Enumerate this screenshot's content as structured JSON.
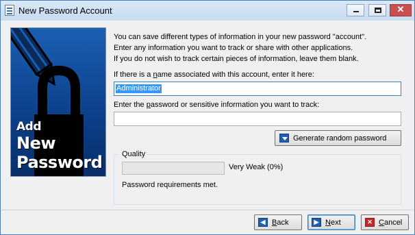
{
  "window": {
    "title": "New Password Account",
    "close_glyph": "✕"
  },
  "banner": {
    "line1": "Add",
    "line2": "New",
    "line3": "Password"
  },
  "intro": {
    "line1": "You can save different types of information in your new password \"account\".",
    "line2": "Enter any information you want to track or share with other applications.",
    "line3": "If you do not wish to track certain pieces of information, leave them blank."
  },
  "name_field": {
    "label_pre": "If there is a ",
    "label_key": "n",
    "label_post": "ame associated with this account, enter it here:",
    "value": "Administrator"
  },
  "password_field": {
    "label_pre": "Enter the ",
    "label_key": "p",
    "label_post": "assword or sensitive information you want to track:",
    "value": ""
  },
  "generate_button": {
    "label": "Generate random password",
    "icon": "chevron-down-icon"
  },
  "quality": {
    "legend": "Quality",
    "strength_text": "Very Weak (0%)",
    "strength_fraction": 0,
    "requirements_text": "Password requirements met."
  },
  "buttons": {
    "back": {
      "key": "B",
      "rest": "ack",
      "icon": "back-arrow-icon",
      "glyph": "◀"
    },
    "next": {
      "key": "N",
      "rest": "ext",
      "icon": "next-arrow-icon",
      "glyph": "▶"
    },
    "cancel": {
      "key": "C",
      "rest": "ancel",
      "icon": "cancel-x-icon",
      "glyph": "✕"
    }
  },
  "colors": {
    "banner_blue": "#0c3f89",
    "selection": "#3399ff",
    "titlebar": "#d9e8f7"
  }
}
